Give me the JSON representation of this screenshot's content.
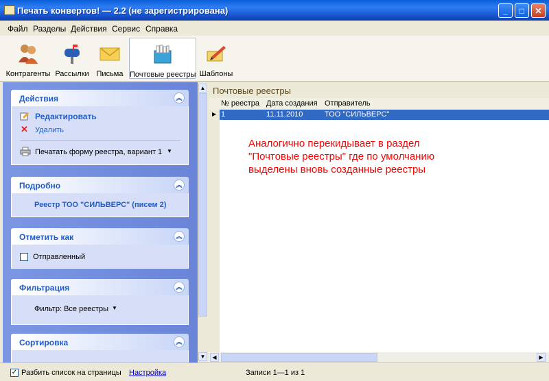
{
  "window": {
    "title": "Печать конвертов! — 2.2 (не зарегистрирована)",
    "min": "_",
    "max": "□",
    "close": "✕"
  },
  "menu": [
    "Файл",
    "Разделы",
    "Действия",
    "Сервис",
    "Справка"
  ],
  "toolbar": [
    {
      "label": "Контрагенты",
      "icon": "contacts-icon"
    },
    {
      "label": "Рассылки",
      "icon": "mailbox-icon"
    },
    {
      "label": "Письма",
      "icon": "envelope-icon"
    },
    {
      "label": "Почтовые реестры",
      "icon": "registry-box-icon",
      "selected": true
    },
    {
      "label": "Шаблоны",
      "icon": "templates-icon"
    }
  ],
  "panels": {
    "actions": {
      "title": "Действия",
      "edit": "Редактировать",
      "delete": "Удалить",
      "print": "Печатать форму реестра, вариант 1"
    },
    "details": {
      "title": "Подробно",
      "text": "Реестр ТОО \"СИЛЬВЕРС\" (писем 2)"
    },
    "mark": {
      "title": "Отметить как",
      "sent": "Отправленный"
    },
    "filter": {
      "title": "Фильтрация",
      "value": "Фильтр: Все реестры"
    },
    "sort": {
      "title": "Сортировка"
    }
  },
  "grid": {
    "title": "Почтовые реестры",
    "columns": [
      "№ реестра",
      "Дата создания",
      "Отправитель"
    ],
    "rows": [
      {
        "num": "1",
        "date": "11.11.2010",
        "sender": "ТОО \"СИЛЬВЕРС\""
      }
    ]
  },
  "note": [
    "Аналогично перекидывает в раздел",
    "\"Почтовые реестры\" где по умолчанию",
    "выделены вновь созданные реестры"
  ],
  "status": {
    "paging": "Разбить список на страницы",
    "settings": "Настройка",
    "records": "Записи 1—1 из 1"
  },
  "colors": {
    "titlebar": "#1550c9",
    "selection": "#316ac5",
    "panel_title": "#215dc6",
    "note": "#ff0000"
  }
}
